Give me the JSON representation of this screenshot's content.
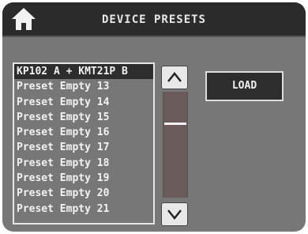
{
  "header": {
    "title": "DEVICE PRESETS",
    "home_icon": "home-icon"
  },
  "preset_list": {
    "items": [
      {
        "label": "KP102 A + KMT21P B",
        "selected": true
      },
      {
        "label": "Preset Empty 13",
        "selected": false
      },
      {
        "label": "Preset Empty 14",
        "selected": false
      },
      {
        "label": "Preset Empty 15",
        "selected": false
      },
      {
        "label": "Preset Empty 16",
        "selected": false
      },
      {
        "label": "Preset Empty 17",
        "selected": false
      },
      {
        "label": "Preset Empty 18",
        "selected": false
      },
      {
        "label": "Preset Empty 19",
        "selected": false
      },
      {
        "label": "Preset Empty 20",
        "selected": false
      },
      {
        "label": "Preset Empty 21",
        "selected": false
      }
    ]
  },
  "scrollbar": {
    "up_icon": "chevron-up-icon",
    "down_icon": "chevron-down-icon"
  },
  "actions": {
    "load_label": "LOAD"
  },
  "colors": {
    "panel": "#777777",
    "header": "#2b2b2b",
    "selected_row": "#2d2d2d",
    "text": "#f2f2f2"
  }
}
